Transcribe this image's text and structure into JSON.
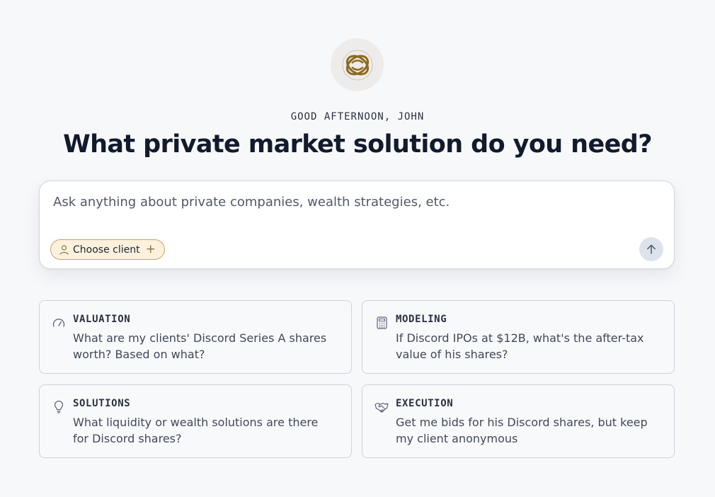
{
  "header": {
    "logo_icon": "interlocking-rings-logo",
    "greeting": "GOOD AFTERNOON, JOHN",
    "headline": "What private market solution do you need?"
  },
  "prompt": {
    "placeholder": "Ask anything about private companies, wealth strategies, etc.",
    "value": "",
    "client_chip": {
      "icon": "person-icon",
      "label": "Choose client",
      "action_icon": "plus-icon"
    },
    "send_icon": "arrow-up-icon"
  },
  "suggestions": [
    {
      "icon": "gauge-icon",
      "category": "VALUATION",
      "question": "What are my clients' Discord Series A shares worth? Based on what?"
    },
    {
      "icon": "calculator-icon",
      "category": "MODELING",
      "question": "If Discord IPOs at $12B, what's the after-tax value of his shares?"
    },
    {
      "icon": "lightbulb-icon",
      "category": "SOLUTIONS",
      "question": "What liquidity or wealth solutions are there for Discord shares?"
    },
    {
      "icon": "handshake-icon",
      "category": "EXECUTION",
      "question": "Get me bids for his Discord shares, but keep my client anonymous"
    }
  ],
  "colors": {
    "background": "#f7f8fa",
    "accent_gold": "#8c6a1f",
    "chip_fill": "#fcf1dc",
    "chip_border": "#c9a36a",
    "heading": "#121a2d"
  }
}
